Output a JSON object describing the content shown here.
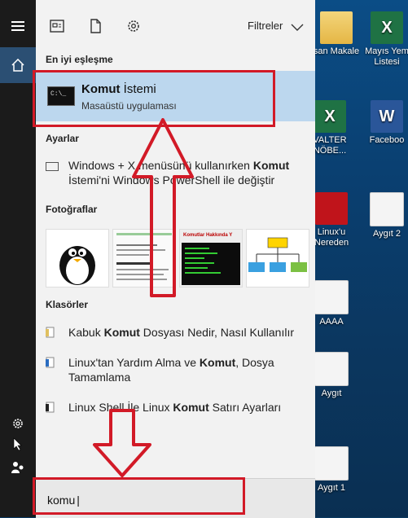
{
  "desktop": {
    "icons": [
      {
        "label": "san Makale",
        "type": "folder"
      },
      {
        "label": "Mayıs Yem\nListesi",
        "type": "excel"
      },
      {
        "label": "VALTER\nNÖBE...",
        "type": "excel"
      },
      {
        "label": "Faceboo",
        "type": "word"
      },
      {
        "label": "Linux'u\nNereden",
        "type": "red"
      },
      {
        "label": "Aygıt 2",
        "type": "doc"
      },
      {
        "label": "AAAA",
        "type": "doc"
      },
      {
        "label": "Aygıt",
        "type": "doc"
      },
      {
        "label": "Aygıt 1",
        "type": "doc"
      }
    ]
  },
  "taskbar": {
    "items": [
      "hamburger-icon",
      "home-icon",
      "settings-icon",
      "user-icon"
    ]
  },
  "topbar": {
    "filters_label": "Filtreler"
  },
  "sections": {
    "best_match": "En iyi eşleşme",
    "settings": "Ayarlar",
    "photos": "Fotoğraflar",
    "folders": "Klasörler"
  },
  "best_match": {
    "title_bold": "Komut",
    "title_rest": " İstemi",
    "subtitle": "Masaüstü uygulaması"
  },
  "settings_item": {
    "pre": "Windows + X menüsünü kullanırken ",
    "bold": "Komut",
    "post": " İstemi'ni Windows PowerShell ile değiştir"
  },
  "photos": [
    {
      "alt": "penguin-photo"
    },
    {
      "alt": "text-document-photo"
    },
    {
      "alt": "komutlar-hakkinda-photo"
    },
    {
      "alt": "diagram-photo"
    }
  ],
  "photo_texts": {
    "p3_title": "Komutlar Hakkında Y"
  },
  "folders": [
    {
      "pre": "Kabuk ",
      "bold": "Komut",
      "post": " Dosyası Nedir, Nasıl Kullanılır"
    },
    {
      "pre": "Linux'tan Yardım Alma ve ",
      "bold": "Komut",
      "post": ", Dosya Tamamlama"
    },
    {
      "pre": "Linux Shell İle Linux ",
      "bold": "Komut",
      "post": " Satırı Ayarları"
    }
  ],
  "search": {
    "value": "komu"
  },
  "colors": {
    "highlight": "#d21a27",
    "selection": "#bcd7ee",
    "taskbar": "#1b1b1b"
  }
}
